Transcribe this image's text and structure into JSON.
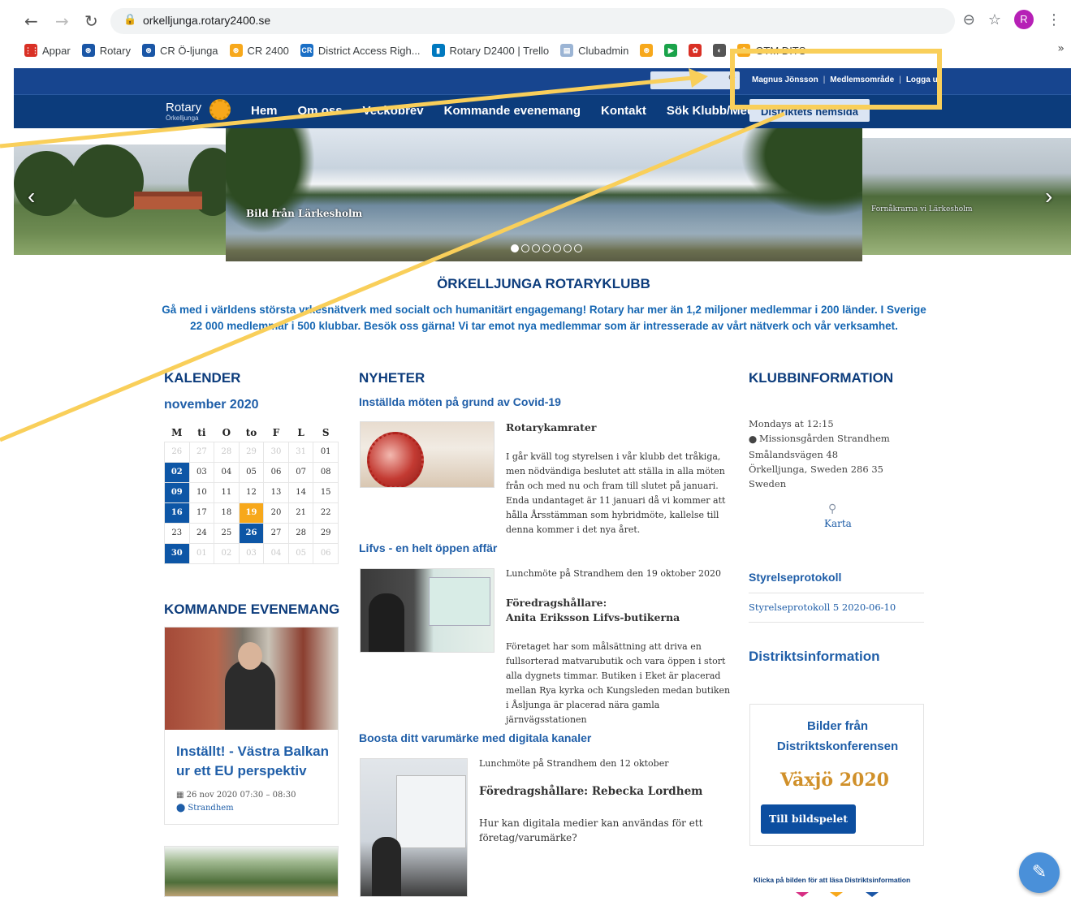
{
  "browser": {
    "url": "orkelljunga.rotary2400.se",
    "avatar_letter": "R",
    "bookmarks": [
      {
        "label": "Appar",
        "color": "#d93025",
        "glyph": "⋮⋮"
      },
      {
        "label": "Rotary",
        "color": "#1a56a6",
        "glyph": "⊛"
      },
      {
        "label": "CR Ö-ljunga",
        "color": "#1a56a6",
        "glyph": "⊛"
      },
      {
        "label": "CR 2400",
        "color": "#f7a81b",
        "glyph": "⊛"
      },
      {
        "label": "District Access Righ...",
        "color": "#1a6fc6",
        "glyph": "CR"
      },
      {
        "label": "Rotary D2400 | Trello",
        "color": "#0079bf",
        "glyph": "▮"
      },
      {
        "label": "Clubadmin",
        "color": "#9bb4d4",
        "glyph": "▤"
      },
      {
        "label": "",
        "color": "#f7a81b",
        "glyph": "⊛"
      },
      {
        "label": "",
        "color": "#1aa34a",
        "glyph": "▶"
      },
      {
        "label": "",
        "color": "#d93025",
        "glyph": "✿"
      },
      {
        "label": "",
        "color": "#555",
        "glyph": "◐"
      },
      {
        "label": "GTM DITS",
        "color": "#f7a81b",
        "glyph": "✱"
      }
    ],
    "more": "»"
  },
  "site": {
    "user_links": [
      "Magnus Jönsson",
      "Medlemsområde",
      "Logga ut"
    ],
    "logo_name": "Rotary",
    "logo_sub": "Örkelljunga",
    "menu": [
      "Hem",
      "Om oss",
      "Veckobrev",
      "Kommande evenemang",
      "Kontakt",
      "Sök Klubb/Medlem"
    ],
    "district_button": "Distriktets hemsida"
  },
  "hero": {
    "caption_main": "Bild från Lärkesholm",
    "caption_right": "Fornåkrarna vi Lärkesholm",
    "slide_count": 7,
    "active_slide": 0
  },
  "intro": {
    "title": "ÖRKELLJUNGA ROTARYKLUBB",
    "text": "Gå med i världens största yrkesnätverk med socialt och humanitärt engagemang! Rotary har mer än 1,2 miljoner medlemmar i 200 länder. I Sverige 22 000 medlemmar i 500 klubbar. Besök oss gärna! Vi tar emot nya medlemmar som är intresserade av vårt nätverk och vår verksamhet."
  },
  "kalender": {
    "heading": "KALENDER",
    "month": "november 2020",
    "weekdays": [
      "M",
      "ti",
      "O",
      "to",
      "F",
      "L",
      "S"
    ],
    "weeks": [
      [
        [
          "26",
          "other"
        ],
        [
          "27",
          "other"
        ],
        [
          "28",
          "other"
        ],
        [
          "29",
          "other"
        ],
        [
          "30",
          "other"
        ],
        [
          "31",
          "other"
        ],
        [
          "01",
          ""
        ]
      ],
      [
        [
          "02",
          "blue"
        ],
        [
          "03",
          ""
        ],
        [
          "04",
          ""
        ],
        [
          "05",
          ""
        ],
        [
          "06",
          ""
        ],
        [
          "07",
          ""
        ],
        [
          "08",
          ""
        ]
      ],
      [
        [
          "09",
          "blue"
        ],
        [
          "10",
          ""
        ],
        [
          "11",
          ""
        ],
        [
          "12",
          ""
        ],
        [
          "13",
          ""
        ],
        [
          "14",
          ""
        ],
        [
          "15",
          ""
        ]
      ],
      [
        [
          "16",
          "blue"
        ],
        [
          "17",
          ""
        ],
        [
          "18",
          ""
        ],
        [
          "19",
          "today"
        ],
        [
          "20",
          ""
        ],
        [
          "21",
          ""
        ],
        [
          "22",
          ""
        ]
      ],
      [
        [
          "23",
          ""
        ],
        [
          "24",
          ""
        ],
        [
          "25",
          ""
        ],
        [
          "26",
          "blue"
        ],
        [
          "27",
          ""
        ],
        [
          "28",
          ""
        ],
        [
          "29",
          ""
        ]
      ],
      [
        [
          "30",
          "blue"
        ],
        [
          "01",
          "other"
        ],
        [
          "02",
          "other"
        ],
        [
          "03",
          "other"
        ],
        [
          "04",
          "other"
        ],
        [
          "05",
          "other"
        ],
        [
          "06",
          "other"
        ]
      ]
    ]
  },
  "evenemang": {
    "heading": "KOMMANDE EVENEMANG",
    "title": "Inställt! - Västra Balkan ur ett EU perspektiv",
    "datetime": "26 nov 2020 07:30 – 08:30",
    "location": "Strandhem"
  },
  "nyheter": {
    "heading": "NYHETER",
    "items": [
      {
        "title": "Inställda möten på grund av Covid-19",
        "subtitle": "Rotarykamrater",
        "body": "I går kväll tog styrelsen i vår klubb det tråkiga, men nödvändiga beslutet att ställa in alla möten från och med nu och fram till slutet på januari. Enda undantaget är 11 januari då vi kommer att hålla Årsstämman som hybridmöte, kallelse till denna kommer i det nya året."
      },
      {
        "title": "Lifvs - en helt öppen affär",
        "lead": "Lunchmöte på Strandhem den 19 oktober 2020",
        "speaker_label": "Föredragshållare:",
        "speaker": "Anita Eriksson Lifvs-butikerna",
        "body": "Företaget har som målsättning att driva en fullsorterad matvarubutik och vara öppen i stort alla dygnets timmar. Butiken i Eket är placerad mellan Rya kyrka och Kungsleden medan butiken i Åsljunga är placerad nära gamla järnvägsstationen"
      },
      {
        "title": "Boosta ditt varumärke med digitala kanaler",
        "lead": "Lunchmöte på Strandhem den 12 oktober",
        "speaker": "Föredragshållare: Rebecka Lordhem",
        "body": "Hur kan digitala medier kan användas för ett företag/varumärke?"
      }
    ]
  },
  "klubbinfo": {
    "heading": "KLUBBINFORMATION",
    "lines": [
      "Mondays at 12:15",
      "Missionsgården Strandhem",
      "Smålandsvägen 48",
      "Örkelljunga, Sweden 286 35",
      "Sweden"
    ],
    "map_label": "Karta",
    "protokoll_heading": "Styrelseprotokoll",
    "protokoll_link": "Styrelseprotokoll 5 2020-06-10",
    "distrikt_heading": "Distriktsinformation",
    "bilder_title": "Bilder från Distriktskonferensen",
    "vaxjo": "Växjö 2020",
    "bild_button": "Till bildspelet",
    "klicka": "Klicka på bilden för att läsa Distriktsinformation"
  },
  "colors": {
    "rotary_blue": "#0c3c7c",
    "link_blue": "#1f5ea8",
    "gold": "#f7a81b",
    "annotation_yellow": "#f9cf5a"
  }
}
